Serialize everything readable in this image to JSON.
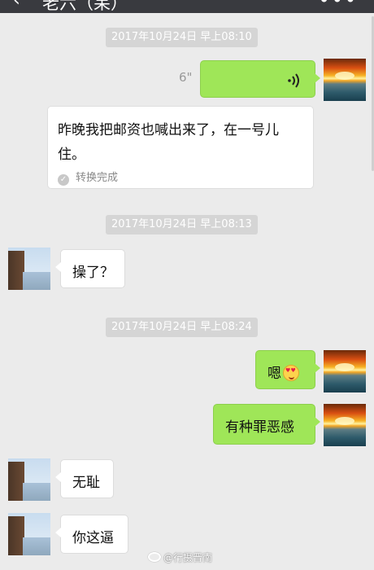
{
  "header": {
    "back_icon": "chevron-left-icon",
    "title": "老六（呆）",
    "more_label": "•••"
  },
  "messages": {
    "ts1": "2017年10月24日 早上08:10",
    "voice_duration": "6\"",
    "transcript_text": "昨晚我把邮资也喊出来了，在一号儿住。",
    "transcript_status": "转换完成",
    "ts2": "2017年10月24日 早上08:13",
    "msg_cao": "操了？",
    "ts3": "2017年10月24日 早上08:24",
    "msg_en": "嗯",
    "msg_guilt": "有种罪恶感",
    "msg_shameless": "无耻",
    "msg_you": "你这逼"
  },
  "watermark": {
    "text": "@行摄晋南"
  },
  "colors": {
    "sent_bubble": "#9fe658",
    "received_bubble": "#ffffff",
    "background": "#ebebeb",
    "timestamp_bg": "#d5d5d5"
  }
}
